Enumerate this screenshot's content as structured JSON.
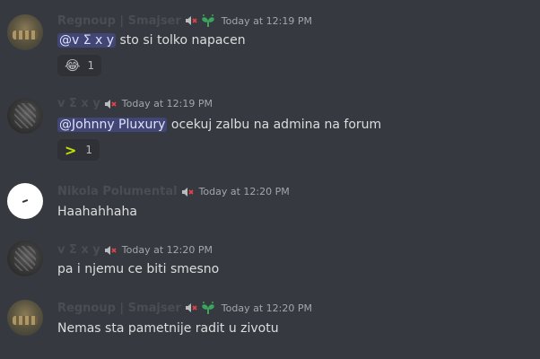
{
  "messages": [
    {
      "username": "Regnoup | Smajser",
      "timestamp": "Today at 12:19 PM",
      "mention": "@v Σ x y",
      "text": "sto si tolko napacen",
      "reaction": {
        "emoji": "😂",
        "count": "1"
      }
    },
    {
      "username": "v Σ x y",
      "timestamp": "Today at 12:19 PM",
      "mention": "@Johnny Pluxury",
      "text": "ocekuj zalbu na admina na forum",
      "reaction": {
        "emoji": ">",
        "count": "1"
      }
    },
    {
      "username": "Nikola Polumental",
      "timestamp": "Today at 12:20 PM",
      "text": "Haahahhaha"
    },
    {
      "username": "v Σ x y",
      "timestamp": "Today at 12:20 PM",
      "text": "pa i njemu ce biti smesno"
    },
    {
      "username": "Regnoup | Smajser",
      "timestamp": "Today at 12:20 PM",
      "text": "Nemas sta pametnije radit u zivotu"
    }
  ],
  "colors": {
    "background": "#36393f",
    "mention_bg": "#414675",
    "mute_red": "#ed4245",
    "leaf_green": "#3ba55d"
  },
  "icons": [
    "muted-speaker-icon",
    "leaf-icon"
  ]
}
